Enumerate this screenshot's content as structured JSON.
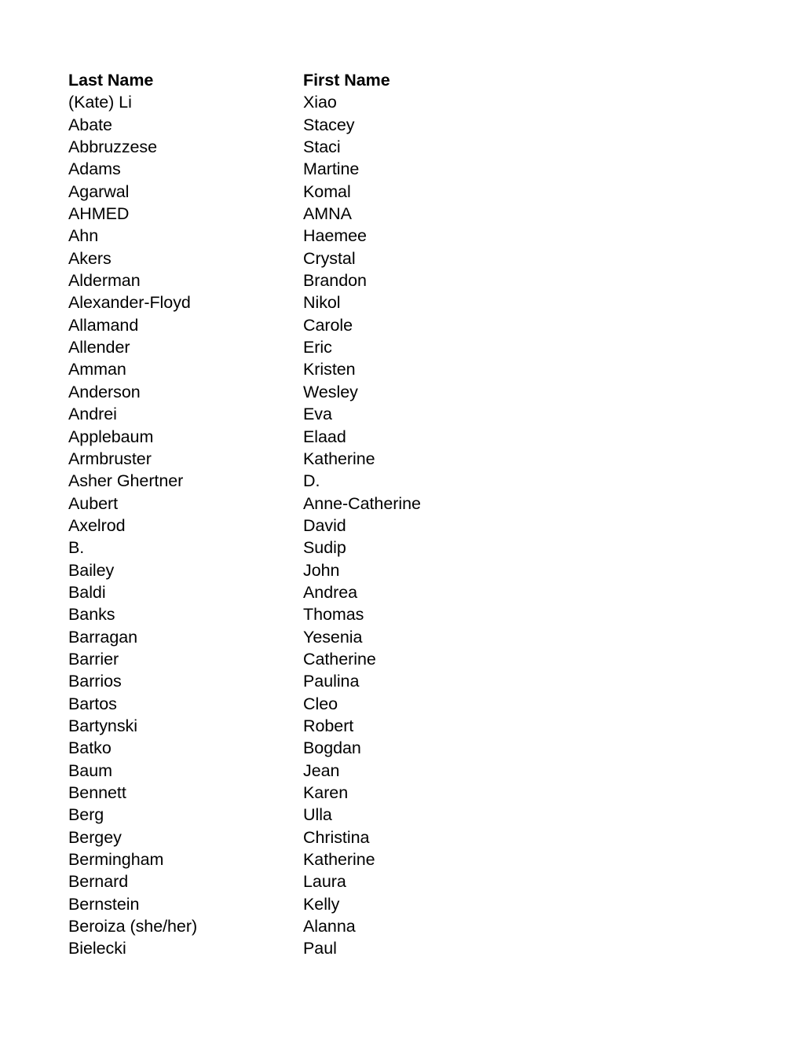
{
  "document": {
    "title": "Last Name / First Name roster",
    "columns": {
      "last_name_header": "Last Name",
      "first_name_header": "First Name"
    },
    "rows": [
      {
        "last": "(Kate) Li",
        "first": "Xiao"
      },
      {
        "last": "Abate",
        "first": "Stacey"
      },
      {
        "last": "Abbruzzese",
        "first": "Staci"
      },
      {
        "last": "Adams",
        "first": "Martine"
      },
      {
        "last": "Agarwal",
        "first": "Komal"
      },
      {
        "last": "AHMED",
        "first": "AMNA"
      },
      {
        "last": "Ahn",
        "first": "Haemee"
      },
      {
        "last": "Akers",
        "first": "Crystal"
      },
      {
        "last": "Alderman",
        "first": "Brandon"
      },
      {
        "last": "Alexander-Floyd",
        "first": "Nikol"
      },
      {
        "last": "Allamand",
        "first": "Carole"
      },
      {
        "last": "Allender",
        "first": "Eric"
      },
      {
        "last": "Amman",
        "first": "Kristen"
      },
      {
        "last": "Anderson",
        "first": "Wesley"
      },
      {
        "last": "Andrei",
        "first": "Eva"
      },
      {
        "last": "Applebaum",
        "first": "Elaad"
      },
      {
        "last": "Armbruster",
        "first": "Katherine"
      },
      {
        "last": "Asher Ghertner",
        "first": "D."
      },
      {
        "last": "Aubert",
        "first": "Anne-Catherine"
      },
      {
        "last": "Axelrod",
        "first": "David"
      },
      {
        "last": "B.",
        "first": "Sudip"
      },
      {
        "last": "Bailey",
        "first": "John"
      },
      {
        "last": "Baldi",
        "first": "Andrea"
      },
      {
        "last": "Banks",
        "first": "Thomas"
      },
      {
        "last": "Barragan",
        "first": "Yesenia"
      },
      {
        "last": "Barrier",
        "first": "Catherine"
      },
      {
        "last": "Barrios",
        "first": "Paulina"
      },
      {
        "last": "Bartos",
        "first": "Cleo"
      },
      {
        "last": "Bartynski",
        "first": "Robert"
      },
      {
        "last": "Batko",
        "first": "Bogdan"
      },
      {
        "last": "Baum",
        "first": "Jean"
      },
      {
        "last": "Bennett",
        "first": "Karen"
      },
      {
        "last": "Berg",
        "first": "Ulla"
      },
      {
        "last": "Bergey",
        "first": "Christina"
      },
      {
        "last": "Bermingham",
        "first": "Katherine"
      },
      {
        "last": "Bernard",
        "first": "Laura"
      },
      {
        "last": "Bernstein",
        "first": "Kelly"
      },
      {
        "last": "Beroiza (she/her)",
        "first": "Alanna"
      },
      {
        "last": "Bielecki",
        "first": "Paul"
      }
    ]
  }
}
